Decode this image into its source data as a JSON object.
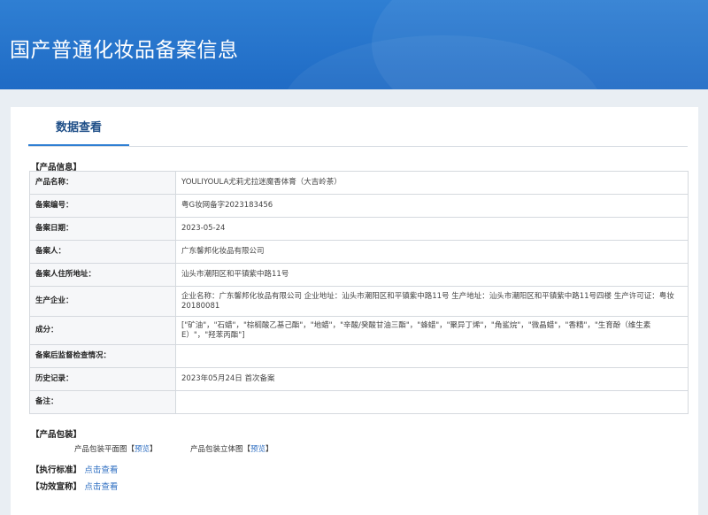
{
  "header": {
    "title": "国产普通化妆品备案信息"
  },
  "tabs": [
    {
      "label": "数据查看"
    }
  ],
  "product_info": {
    "section_label": "【产品信息】",
    "rows": [
      {
        "label": "产品名称：",
        "value": "YOULIYOULA尤莉尤拉迷魔香体膏（大吉岭茶）"
      },
      {
        "label": "备案编号：",
        "value": "粤G妆网备字2023183456"
      },
      {
        "label": "备案日期：",
        "value": "2023-05-24"
      },
      {
        "label": "备案人：",
        "value": "广东馨邦化妆品有限公司"
      },
      {
        "label": "备案人住所地址：",
        "value": "汕头市潮阳区和平镇紫中路11号"
      },
      {
        "label": "生产企业：",
        "value": "企业名称：广东馨邦化妆品有限公司 企业地址：汕头市潮阳区和平镇紫中路11号 生产地址：汕头市潮阳区和平镇紫中路11号四楼 生产许可证：粤妆20180081"
      },
      {
        "label": "成分：",
        "value": "[\"矿油\"，\"石蜡\"，\"棕榈酸乙基己酯\"，\"地蜡\"，\"辛酸/癸酸甘油三酯\"，\"蜂蜡\"，\"聚异丁烯\"，\"角鲨烷\"，\"微晶蜡\"，\"香精\"，\"生育酚（维生素E）\"，\"羟苯丙酯\"]"
      },
      {
        "label": "备案后监督检查情况：",
        "value": ""
      },
      {
        "label": "历史记录：",
        "value": "2023年05月24日 首次备案"
      },
      {
        "label": "备注：",
        "value": ""
      }
    ]
  },
  "packaging": {
    "section_label": "【产品包装】",
    "flat_label": "产品包装平面图",
    "flat_link": "预览",
    "solid_label": "产品包装立体图",
    "solid_link": "预览"
  },
  "standard": {
    "section_label": "【执行标准】",
    "link": "点击查看"
  },
  "efficacy": {
    "section_label": "【功效宣称】",
    "link": "点击查看"
  }
}
